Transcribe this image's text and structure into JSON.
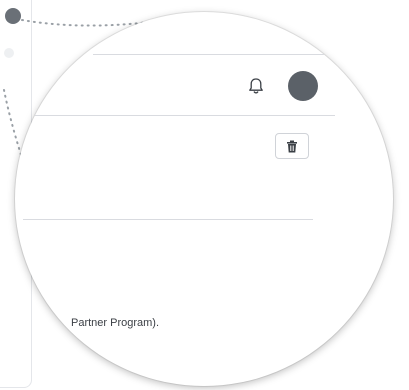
{
  "header": {
    "notifications_icon": "bell-icon",
    "avatar_icon": "user-avatar"
  },
  "actions": {
    "delete_icon": "trash-icon"
  },
  "content": {
    "text": "Partner Program)."
  },
  "colors": {
    "avatar": "#5b6168",
    "icon": "#3a3f45",
    "divider": "#d9dbe0",
    "dotted_connector": "#9aa0a6"
  }
}
